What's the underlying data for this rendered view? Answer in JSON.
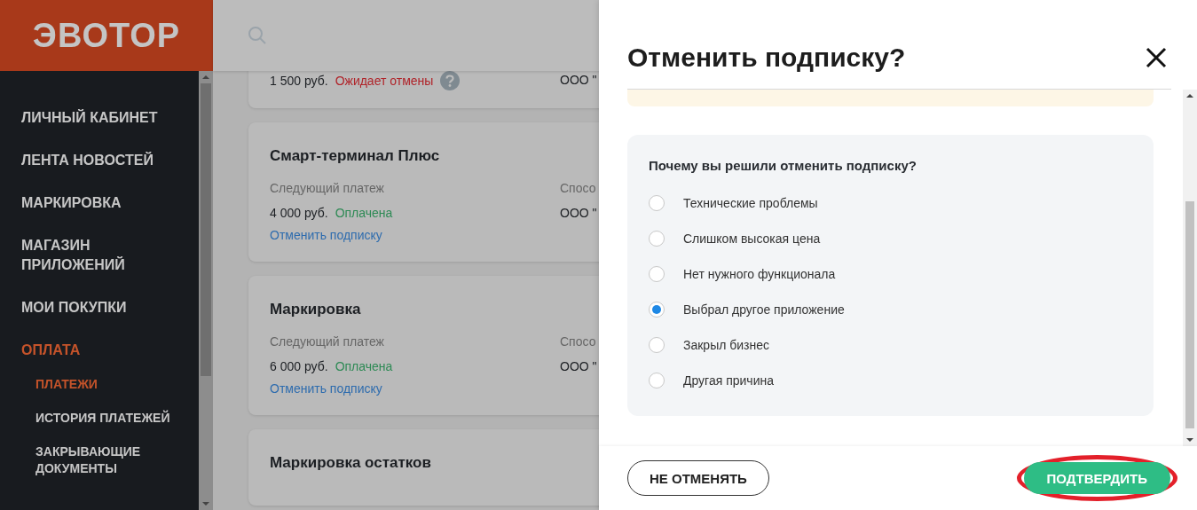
{
  "logo": "ЭВОТОР",
  "sidebar": {
    "items": [
      {
        "label": "ЛИЧНЫЙ КАБИНЕТ",
        "selected": false
      },
      {
        "label": "ЛЕНТА НОВОСТЕЙ",
        "selected": false
      },
      {
        "label": "МАРКИРОВКА",
        "selected": false
      },
      {
        "label": "МАГАЗИН ПРИЛОЖЕНИЙ",
        "selected": false
      },
      {
        "label": "МОИ ПОКУПКИ",
        "selected": false
      },
      {
        "label": "ОПЛАТА",
        "selected": true,
        "children": [
          {
            "label": "ПЛАТЕЖИ",
            "selected": true
          },
          {
            "label": "ИСТОРИЯ ПЛАТЕЖЕЙ",
            "selected": false
          },
          {
            "label": "ЗАКРЫВАЮЩИЕ ДОКУМЕНТЫ",
            "selected": false
          }
        ]
      }
    ]
  },
  "cards": [
    {
      "amount": "1 500 руб.",
      "status": "Ожидает отмены",
      "color": "#b0242a",
      "has_help": true,
      "right_value": "ООО \""
    },
    {
      "title": "Смарт-терминал Плюс",
      "next_label": "Следующий платеж",
      "amount": "4 000 руб.",
      "status": "Оплачена",
      "color": "#2e8a55",
      "has_help": false,
      "link": "Отменить подписку",
      "right_label": "Спосо",
      "right_value": "ООО \""
    },
    {
      "title": "Маркировка",
      "next_label": "Следующий платеж",
      "amount": "6 000 руб.",
      "status": "Оплачена",
      "color": "#2e8a55",
      "has_help": false,
      "link": "Отменить подписку",
      "right_label": "Спосо",
      "right_value": "ООО \""
    },
    {
      "title": "Маркировка остатков"
    }
  ],
  "dialog": {
    "title": "Отменить подписку?",
    "question": "Почему вы решили отменить подписку?",
    "options": [
      {
        "label": "Технические проблемы",
        "selected": false
      },
      {
        "label": "Слишком высокая цена",
        "selected": false
      },
      {
        "label": "Нет нужного функционала",
        "selected": false
      },
      {
        "label": "Выбрал другое приложение",
        "selected": true
      },
      {
        "label": "Закрыл бизнес",
        "selected": false
      },
      {
        "label": "Другая причина",
        "selected": false
      }
    ],
    "cancel_button": "НЕ ОТМЕНЯТЬ",
    "confirm_button": "ПОДТВЕРДИТЬ"
  }
}
